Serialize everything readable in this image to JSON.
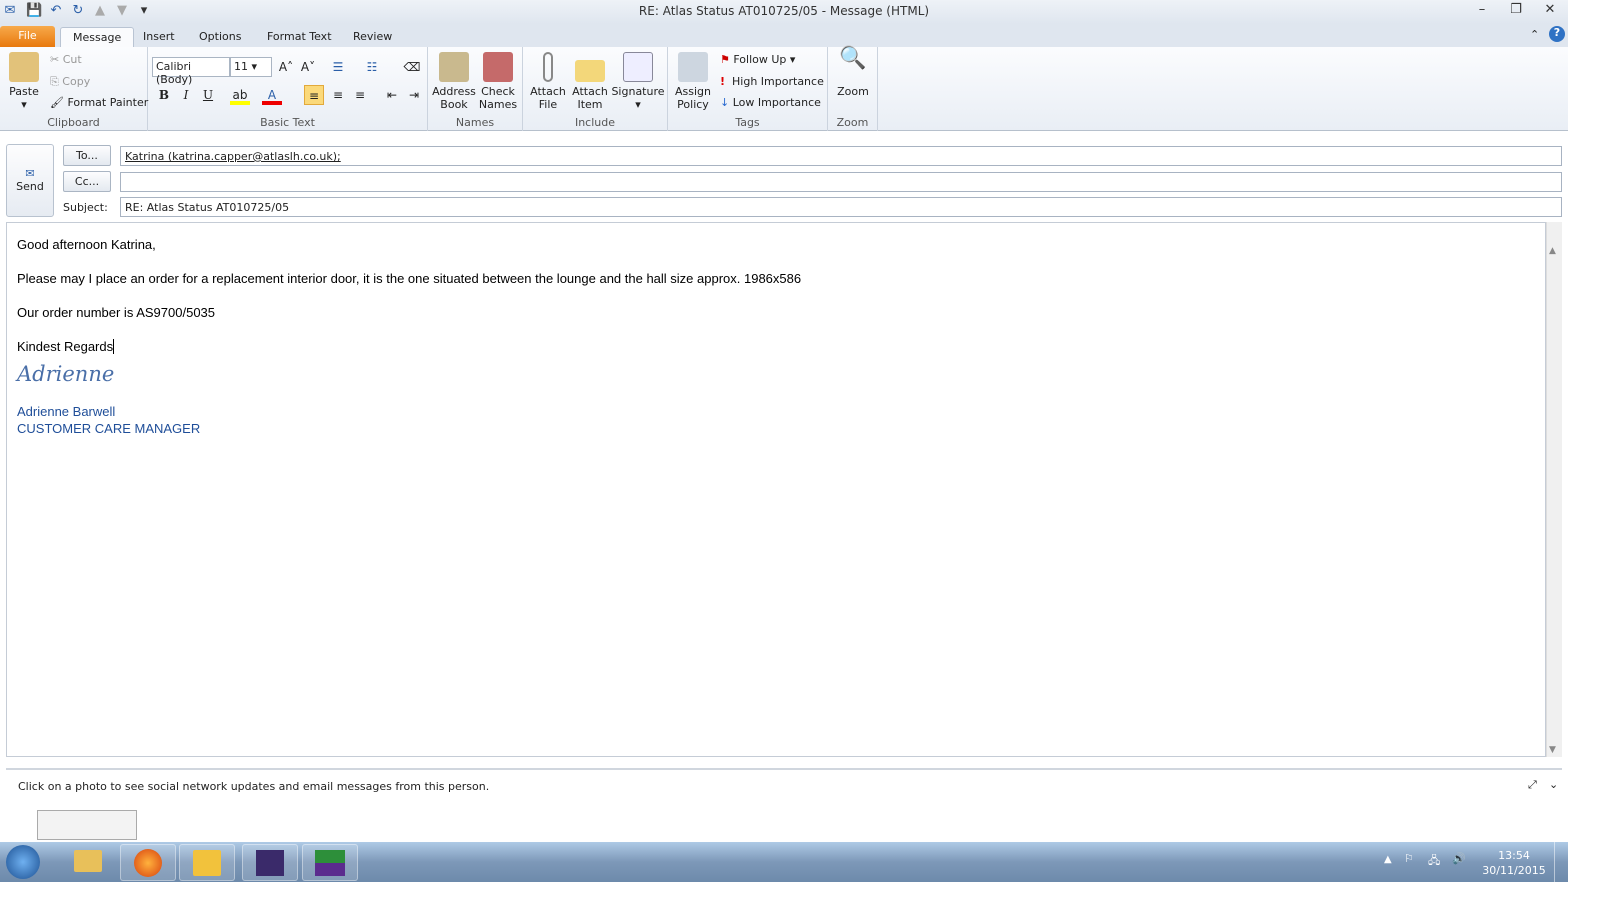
{
  "window": {
    "title": "RE: Atlas Status AT010725/05  -  Message (HTML)"
  },
  "tabs": [
    "File",
    "Message",
    "Insert",
    "Options",
    "Format Text",
    "Review"
  ],
  "ribbon": {
    "clipboard": {
      "label": "Clipboard",
      "paste": "Paste",
      "cut": "Cut",
      "copy": "Copy",
      "format_painter": "Format Painter"
    },
    "basic_text": {
      "label": "Basic Text",
      "font": "Calibri (Body)",
      "size": "11",
      "bold": "B",
      "italic": "I",
      "underline": "U"
    },
    "names": {
      "label": "Names",
      "address_book": "Address Book",
      "check_names": "Check Names"
    },
    "include": {
      "label": "Include",
      "attach_file": "Attach File",
      "attach_item": "Attach Item",
      "signature": "Signature"
    },
    "tags": {
      "label": "Tags",
      "assign_policy": "Assign Policy",
      "follow_up": "Follow Up",
      "high": "High Importance",
      "low": "Low Importance"
    },
    "zoom": {
      "label": "Zoom",
      "zoom": "Zoom"
    }
  },
  "compose": {
    "send": "Send",
    "to_btn": "To...",
    "cc_btn": "Cc...",
    "subject_label": "Subject:",
    "to": "Katrina (katrina.capper@atlaslh.co.uk);",
    "cc": "",
    "subject": "RE: Atlas Status AT010725/05"
  },
  "message": {
    "greeting": "Good afternoon Katrina,",
    "para1": "Please may I place an order for a replacement interior door, it is the one situated between the lounge and the hall size approx. 1986x586",
    "para2": "Our order number is AS9700/5035",
    "closing": "Kindest Regards",
    "signature_script": "Adrienne",
    "sig_name": "Adrienne Barwell",
    "sig_title": "CUSTOMER CARE MANAGER"
  },
  "people_pane": {
    "text": "Click on a photo to see social network updates and email messages from this person."
  },
  "taskbar": {
    "time": "13:54",
    "date": "30/11/2015"
  }
}
